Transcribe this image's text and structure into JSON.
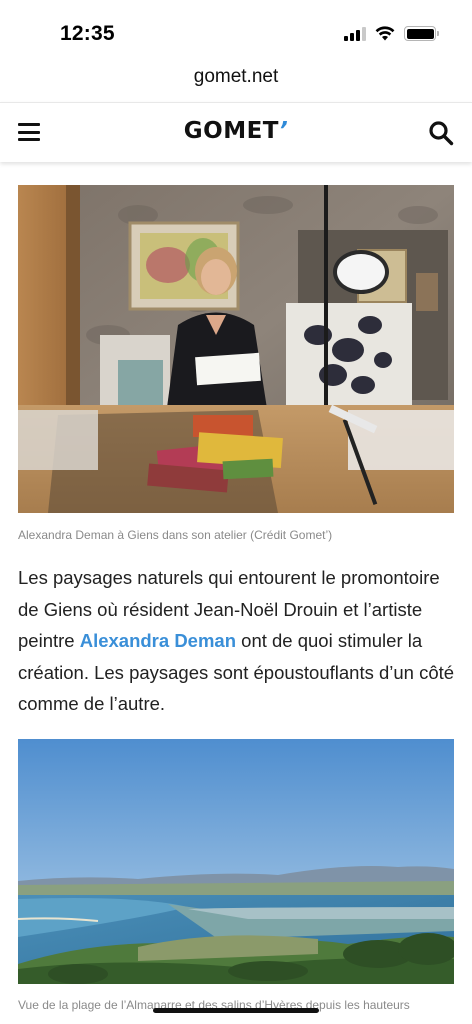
{
  "status": {
    "time": "12:35",
    "signal_bars": 4,
    "signal_active": 3,
    "battery_level": 1.0
  },
  "browser": {
    "url": "gomet.net"
  },
  "header": {
    "logo_text": "GOMET",
    "logo_accent": "’"
  },
  "article": {
    "image1": {
      "caption": "Alexandra Deman à Giens dans son atelier (Crédit Gomet’)"
    },
    "paragraph": {
      "before_link": "Les paysages naturels qui entourent le promontoire de Giens où résident Jean-Noël Drouin et l’artiste peintre ",
      "link_text": "Alexandra Deman",
      "after_link": " ont de quoi stimuler la création. Les paysages sont époustouflants d’un côté comme de l’autre."
    },
    "image2": {
      "caption": "Vue de la plage de l’Almanarre et des salins d’Hyères depuis les hauteurs"
    }
  },
  "colors": {
    "link": "#3a8fd8",
    "logo_accent": "#2f8ad8",
    "caption": "#8a8a8a"
  },
  "icons": [
    "menu-icon",
    "search-icon",
    "signal-icon",
    "wifi-icon",
    "battery-icon"
  ]
}
